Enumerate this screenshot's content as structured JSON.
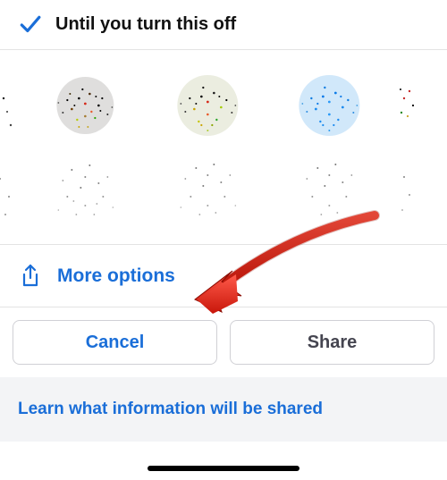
{
  "option": {
    "label": "Until you turn this off"
  },
  "more_options": {
    "label": "More options"
  },
  "buttons": {
    "cancel": "Cancel",
    "share": "Share"
  },
  "learn": {
    "label": "Learn what information will be shared"
  },
  "icons": {
    "check": "check-icon",
    "share": "share-up-icon"
  },
  "thumbnails": [
    {
      "name": "contact-thumb-1"
    },
    {
      "name": "contact-thumb-2"
    },
    {
      "name": "contact-thumb-3"
    },
    {
      "name": "contact-thumb-4"
    }
  ],
  "annotation": {
    "arrow_color": "#e8332a"
  }
}
